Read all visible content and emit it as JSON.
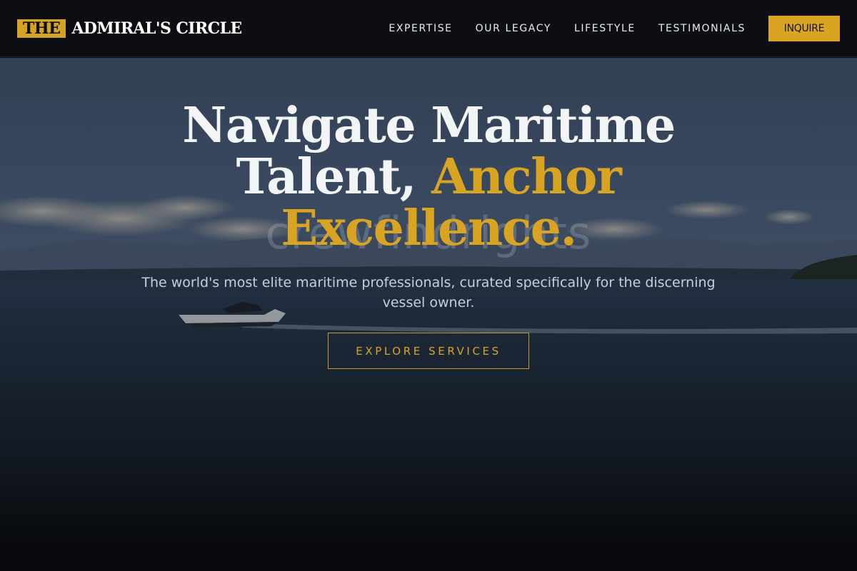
{
  "brand": {
    "badge": "THE",
    "name": "ADMIRAL'S CIRCLE"
  },
  "nav": {
    "links": [
      "EXPERTISE",
      "OUR LEGACY",
      "LIFESTYLE",
      "TESTIMONIALS"
    ],
    "cta": "INQUIRE"
  },
  "hero": {
    "headline_line1": "Navigate Maritime",
    "headline_line2_plain": "Talent,",
    "headline_line2_accent": "Anchor",
    "headline_line3": "Excellence.",
    "background_text": "crewfindrights",
    "subtext": "The world's most elite maritime professionals, curated specifically for the discerning vessel owner.",
    "cta": "EXPLORE SERVICES"
  },
  "colors": {
    "accent": "#d9a422",
    "nav_background": "#0c0e11",
    "headline": "#f3f4f6"
  }
}
